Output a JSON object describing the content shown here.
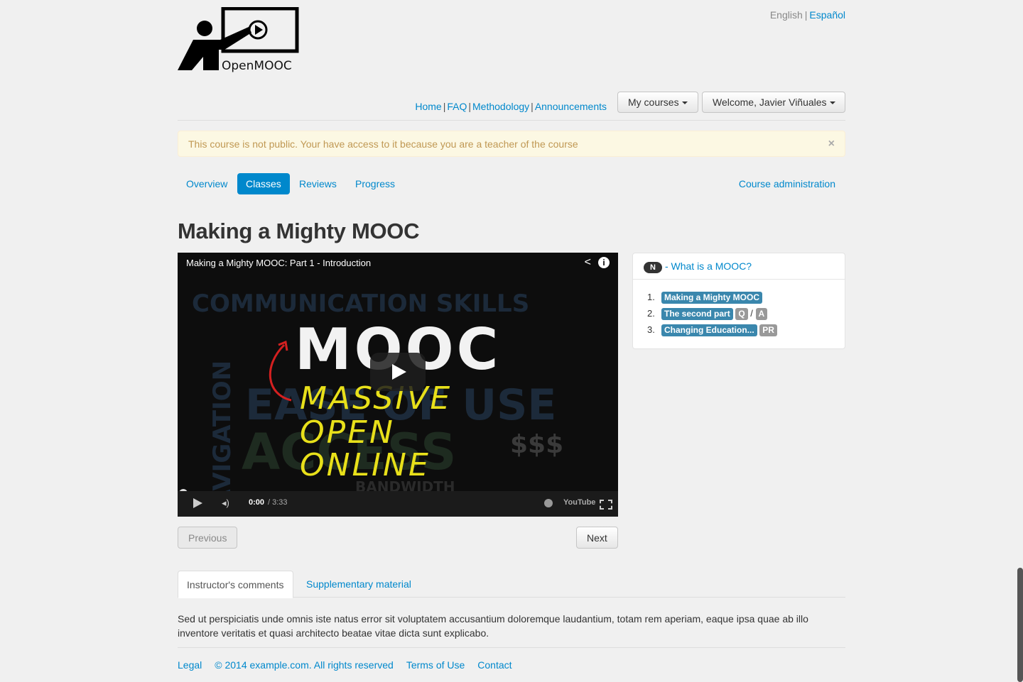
{
  "brand": {
    "logo_text": "OpenMOOC"
  },
  "lang": {
    "current": "English",
    "other": "Español"
  },
  "nav": {
    "home": "Home",
    "faq": "FAQ",
    "methodology": "Methodology",
    "announcements": "Announcements",
    "my_courses": "My courses",
    "welcome": "Welcome, Javier Viñuales"
  },
  "alert": {
    "text": "This course is not public. Your have access to it because you are a teacher of the course",
    "close": "×"
  },
  "course_tabs": {
    "overview": "Overview",
    "classes": "Classes",
    "reviews": "Reviews",
    "progress": "Progress",
    "admin": "Course administration"
  },
  "page": {
    "title": "Making a Mighty MOOC"
  },
  "video": {
    "title": "Making a Mighty MOOC: Part 1 - Introduction",
    "big_word": "MOOC",
    "hand_lines": [
      "MASSIVE",
      "OPEN",
      "ONLINE"
    ],
    "bg_words": [
      "COMMUNICATION SKILLS",
      "NAVIGATION",
      "EASE OF USE",
      "ACCESS",
      "$$$",
      "BANDWIDTH"
    ],
    "time_current": "0:00",
    "time_total": "/ 3:33",
    "brand": "YouTube",
    "progress": 0
  },
  "sidebar": {
    "badge": "N",
    "header_link": "- What is a MOOC?",
    "items": [
      {
        "num": "1.",
        "label": "Making a Mighty MOOC",
        "extras": []
      },
      {
        "num": "2.",
        "label": "The second part",
        "extras": [
          "Q",
          "A"
        ]
      },
      {
        "num": "3.",
        "label": "Changing Education...",
        "extras": [
          "PR"
        ]
      }
    ]
  },
  "pager": {
    "previous": "Previous",
    "next": "Next"
  },
  "bottom_tabs": {
    "comments": "Instructor's comments",
    "material": "Supplementary material"
  },
  "comment": {
    "text": "Sed ut perspiciatis unde omnis iste natus error sit voluptatem accusantium doloremque laudantium, totam rem aperiam, eaque ipsa quae ab illo inventore veritatis et quasi architecto beatae vitae dicta sunt explicabo."
  },
  "footer": {
    "legal": "Legal",
    "copyright": "© 2014 example.com. All rights reserved",
    "terms": "Terms of Use",
    "contact": "Contact"
  }
}
